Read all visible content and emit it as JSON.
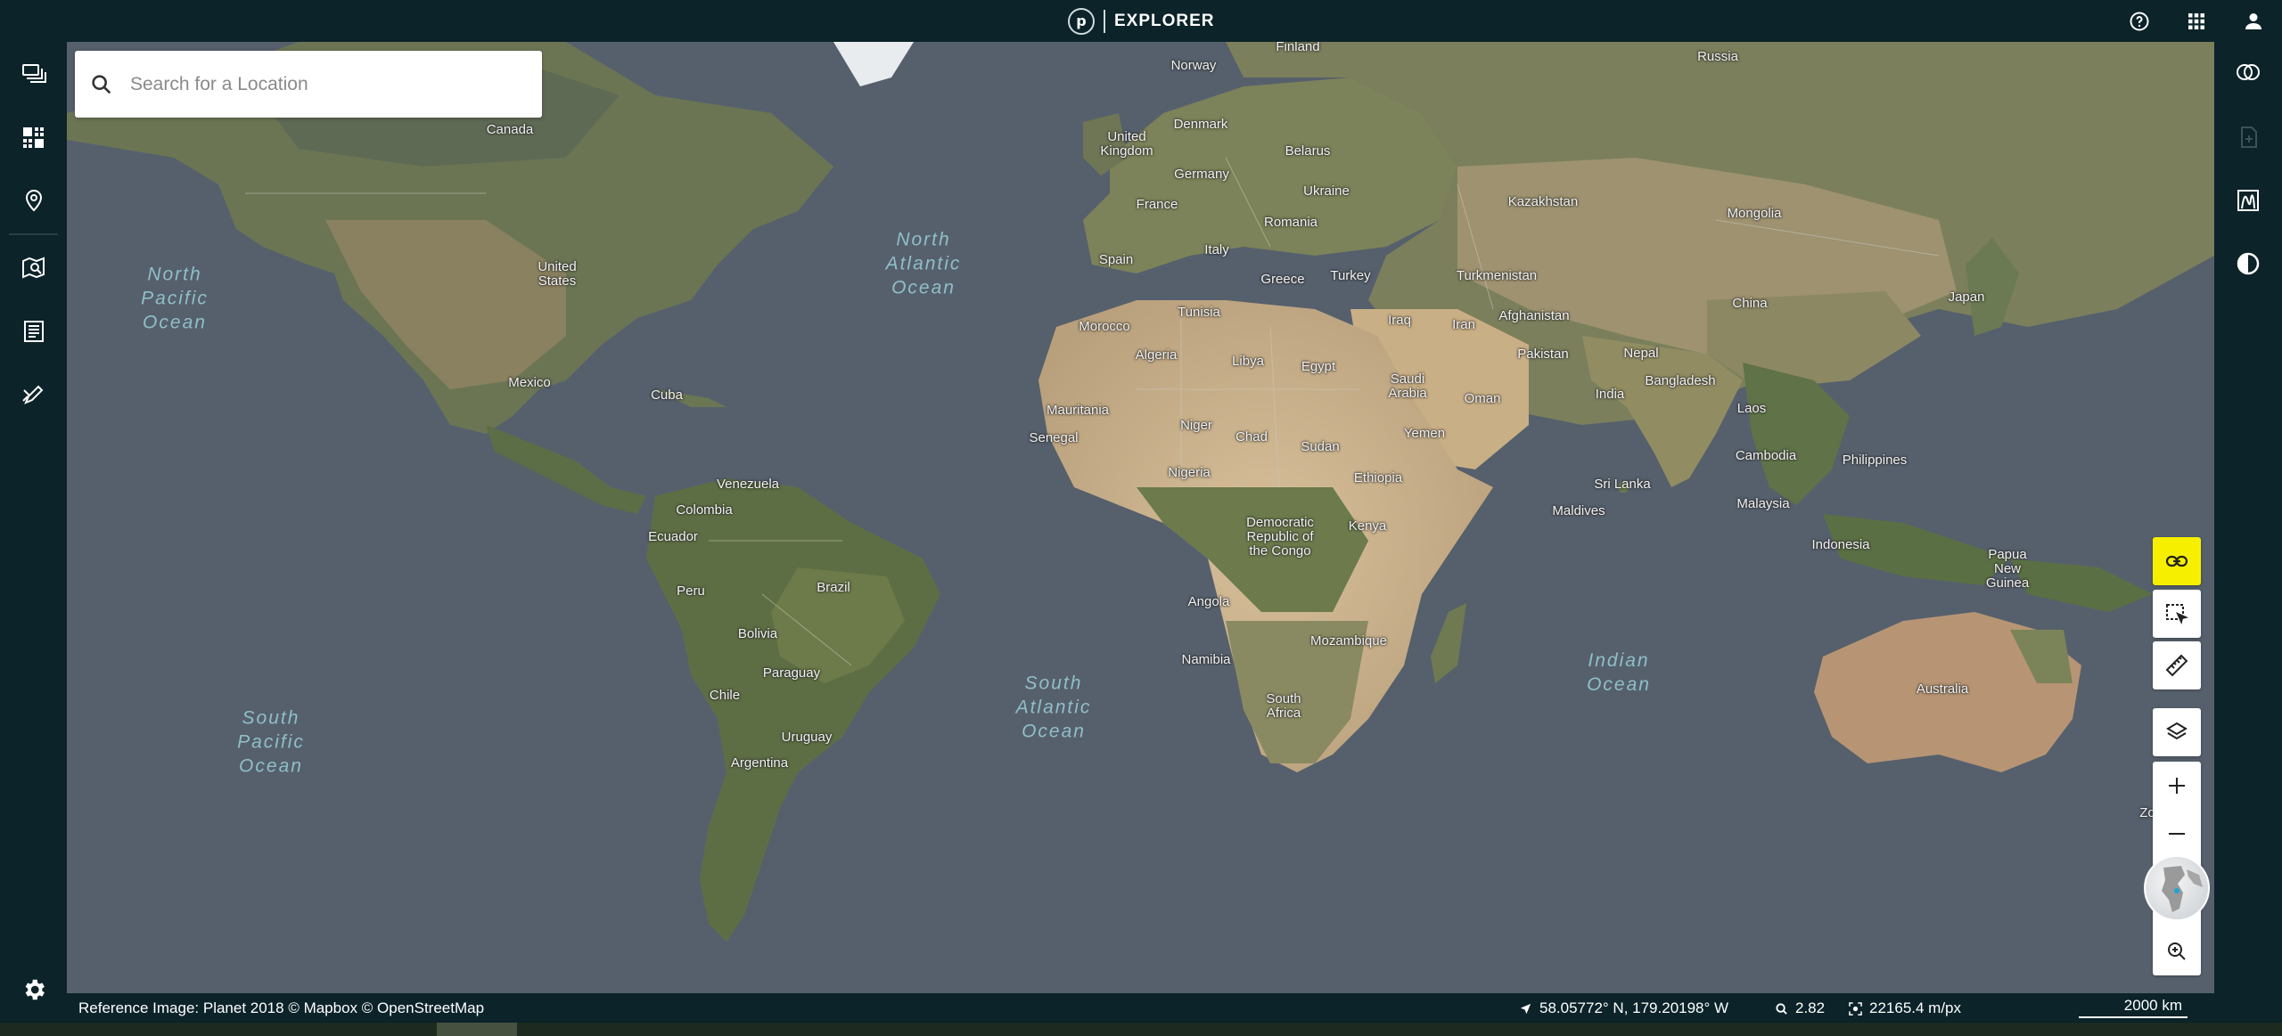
{
  "app": {
    "logo_letter": "p",
    "name": "EXPLORER"
  },
  "colors": {
    "chrome": "#0b2329",
    "ocean": "#56606c",
    "active_control": "#f6f000"
  },
  "top_right_icons": [
    "help-icon",
    "apps-grid-icon",
    "user-icon"
  ],
  "left_sidebar_icons": [
    "layers-stack-icon",
    "mosaic-grid-icon",
    "location-pin-icon",
    "map-search-icon",
    "report-icon",
    "draw-tool-icon",
    "settings-gear-icon"
  ],
  "right_sidebar_icons": [
    "compare-icon",
    "add-image-icon",
    "elevation-icon",
    "contrast-icon"
  ],
  "search": {
    "placeholder": "Search for a Location"
  },
  "map_controls": [
    "link-icon",
    "select-area-icon",
    "ruler-icon",
    "layers-icon",
    "zoom-in-icon",
    "zoom-out-icon",
    "globe-icon",
    "magnify-icon"
  ],
  "oceans": [
    {
      "name": "North\nPacific\nOcean"
    },
    {
      "name": "North\nAtlantic\nOcean"
    },
    {
      "name": "South\nAtlantic\nOcean"
    },
    {
      "name": "South\nPacific\nOcean"
    },
    {
      "name": "Indian\nOcean"
    }
  ],
  "countries": [
    "Finland",
    "Norway",
    "Russia",
    "Canada",
    "Denmark",
    "United\nKingdom",
    "Belarus",
    "Germany",
    "Ukraine",
    "France",
    "Romania",
    "Kazakhstan",
    "Mongolia",
    "United\nStates",
    "Italy",
    "Spain",
    "Greece",
    "Turkey",
    "Turkmenistan",
    "China",
    "Japan",
    "Tunisia",
    "Morocco",
    "Iraq",
    "Iran",
    "Afghanistan",
    "Algeria",
    "Libya",
    "Egypt",
    "Pakistan",
    "Nepal",
    "Mexico",
    "Saudi\nArabia",
    "India",
    "Bangladesh",
    "Cuba",
    "Oman",
    "Mauritania",
    "Laos",
    "Senegal",
    "Niger",
    "Chad",
    "Sudan",
    "Yemen",
    "Cambodia",
    "Philippines",
    "Nigeria",
    "Ethiopia",
    "Venezuela",
    "Sri Lanka",
    "Colombia",
    "Maldives",
    "Malaysia",
    "Democratic\nRepublic of\nthe Congo",
    "Kenya",
    "Ecuador",
    "Indonesia",
    "Papua\nNew\nGuinea",
    "Brazil",
    "Peru",
    "Angola",
    "Bolivia",
    "Mozambique",
    "Namibia",
    "Paraguay",
    "Chile",
    "South\nAfrica",
    "Australia",
    "Uruguay",
    "Argentina",
    "Zo"
  ],
  "footer": {
    "attribution": "Reference Image: Planet 2018 © Mapbox © OpenStreetMap",
    "coordinates": "58.05772° N, 179.20198° W",
    "zoom": "2.82",
    "resolution": "22165.4 m/px",
    "scale": "2000 km"
  }
}
